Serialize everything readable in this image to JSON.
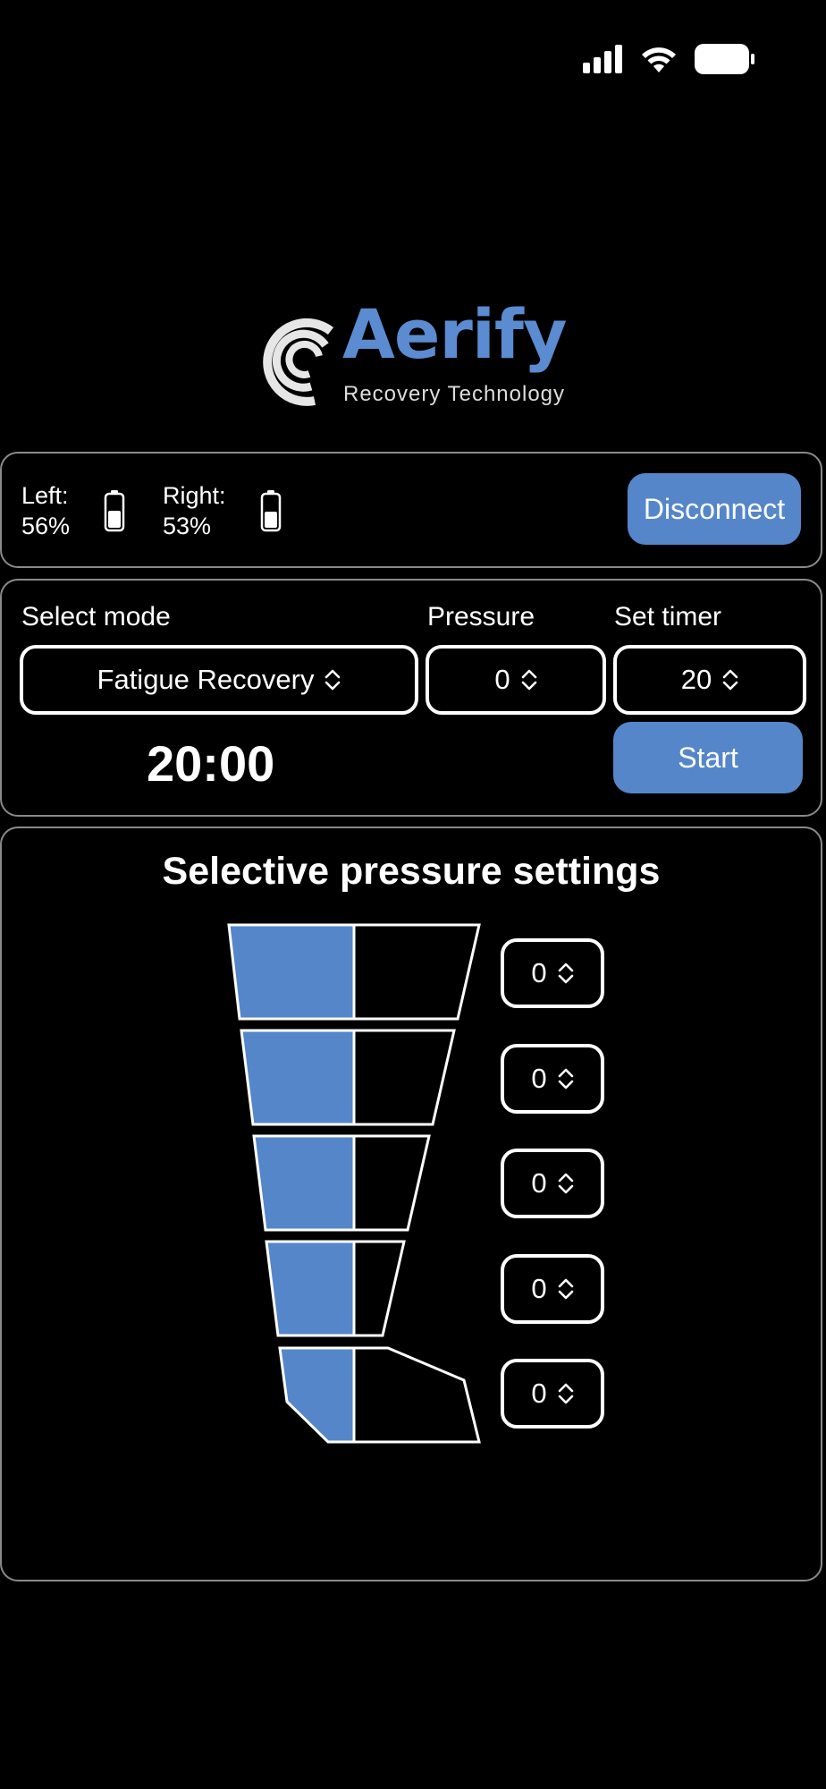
{
  "status_bar": {
    "icons": [
      "signal-icon",
      "wifi-icon",
      "battery-icon"
    ]
  },
  "logo": {
    "name": "Aerify",
    "tagline": "Recovery Technology",
    "brand_color": "#5B8BD0"
  },
  "battery": {
    "left_label": "Left:",
    "left_value": "56%",
    "right_label": "Right:",
    "right_value": "53%",
    "disconnect_label": "Disconnect"
  },
  "session": {
    "mode_label": "Select mode",
    "mode_value": "Fatigue Recovery",
    "pressure_label": "Pressure",
    "pressure_value": "0",
    "timer_label": "Set timer",
    "timer_value": "20",
    "countdown": "20:00",
    "start_label": "Start"
  },
  "selective": {
    "title": "Selective pressure settings",
    "zones": [
      {
        "value": "0"
      },
      {
        "value": "0"
      },
      {
        "value": "0"
      },
      {
        "value": "0"
      },
      {
        "value": "0"
      }
    ],
    "active_color": "#5586C9"
  }
}
